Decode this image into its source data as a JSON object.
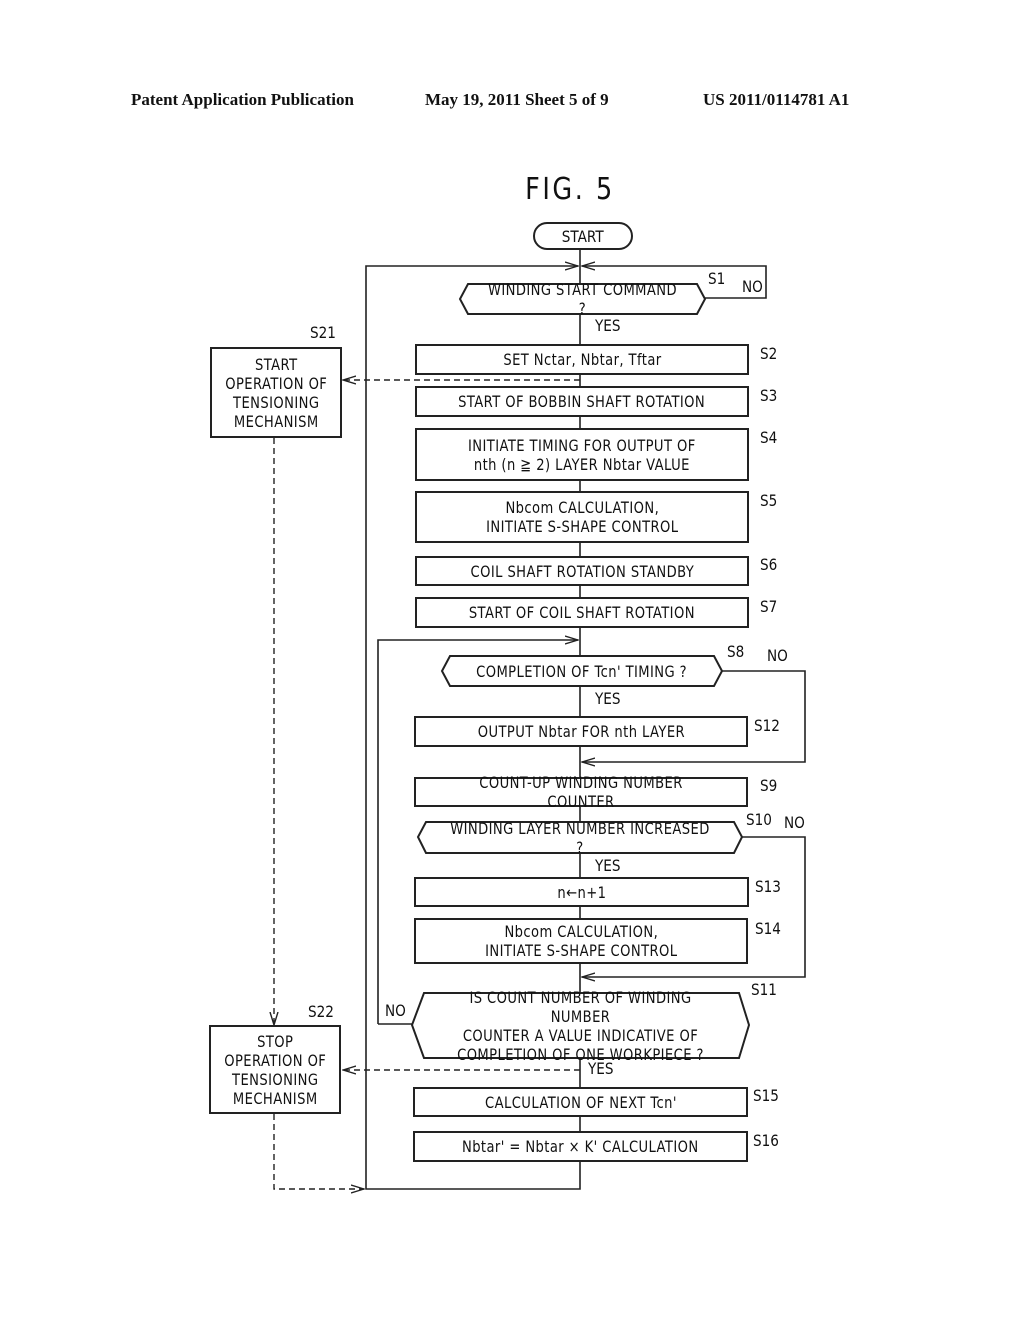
{
  "header": {
    "publication": "Patent Application Publication",
    "date_sheet": "May 19, 2011  Sheet 5 of 9",
    "number": "US 2011/0114781 A1"
  },
  "figure": {
    "title": "FIG. 5",
    "start": "START",
    "steps": {
      "s1": {
        "id": "S1",
        "type": "decision",
        "text": "WINDING START COMMAND ?",
        "yes": "YES",
        "no": "NO"
      },
      "s2": {
        "id": "S2",
        "type": "process",
        "text": "SET Nctar, Nbtar, Tftar"
      },
      "s3": {
        "id": "S3",
        "type": "process",
        "text": "START OF BOBBIN SHAFT ROTATION"
      },
      "s4": {
        "id": "S4",
        "type": "process",
        "text": "INITIATE TIMING FOR OUTPUT OF\nnth (n ≧ 2) LAYER Nbtar VALUE"
      },
      "s5": {
        "id": "S5",
        "type": "process",
        "text": "Nbcom CALCULATION,\nINITIATE S-SHAPE CONTROL"
      },
      "s6": {
        "id": "S6",
        "type": "process",
        "text": "COIL SHAFT ROTATION STANDBY"
      },
      "s7": {
        "id": "S7",
        "type": "process",
        "text": "START OF COIL SHAFT ROTATION"
      },
      "s8": {
        "id": "S8",
        "type": "decision",
        "text": "COMPLETION OF Tcn' TIMING ?",
        "yes": "YES",
        "no": "NO"
      },
      "s12": {
        "id": "S12",
        "type": "process",
        "text": "OUTPUT Nbtar FOR nth LAYER"
      },
      "s9": {
        "id": "S9",
        "type": "process",
        "text": "COUNT-UP WINDING NUMBER COUNTER"
      },
      "s10": {
        "id": "S10",
        "type": "decision",
        "text": "WINDING LAYER NUMBER INCREASED ?",
        "yes": "YES",
        "no": "NO"
      },
      "s13": {
        "id": "S13",
        "type": "process",
        "text": "n←n+1"
      },
      "s14": {
        "id": "S14",
        "type": "process",
        "text": "Nbcom CALCULATION,\nINITIATE S-SHAPE CONTROL"
      },
      "s11": {
        "id": "S11",
        "type": "decision",
        "text": "IS COUNT NUMBER OF WINDING NUMBER\nCOUNTER A VALUE INDICATIVE OF\nCOMPLETION OF ONE WORKPIECE ?",
        "yes": "YES",
        "no": "NO"
      },
      "s15": {
        "id": "S15",
        "type": "process",
        "text": "CALCULATION OF NEXT Tcn'"
      },
      "s16": {
        "id": "S16",
        "type": "process",
        "text": "Nbtar' = Nbtar × K' CALCULATION"
      },
      "s21": {
        "id": "S21",
        "type": "process",
        "text": "START\nOPERATION OF\nTENSIONING\nMECHANISM"
      },
      "s22": {
        "id": "S22",
        "type": "process",
        "text": "STOP\nOPERATION OF\nTENSIONING\nMECHANISM"
      }
    }
  }
}
